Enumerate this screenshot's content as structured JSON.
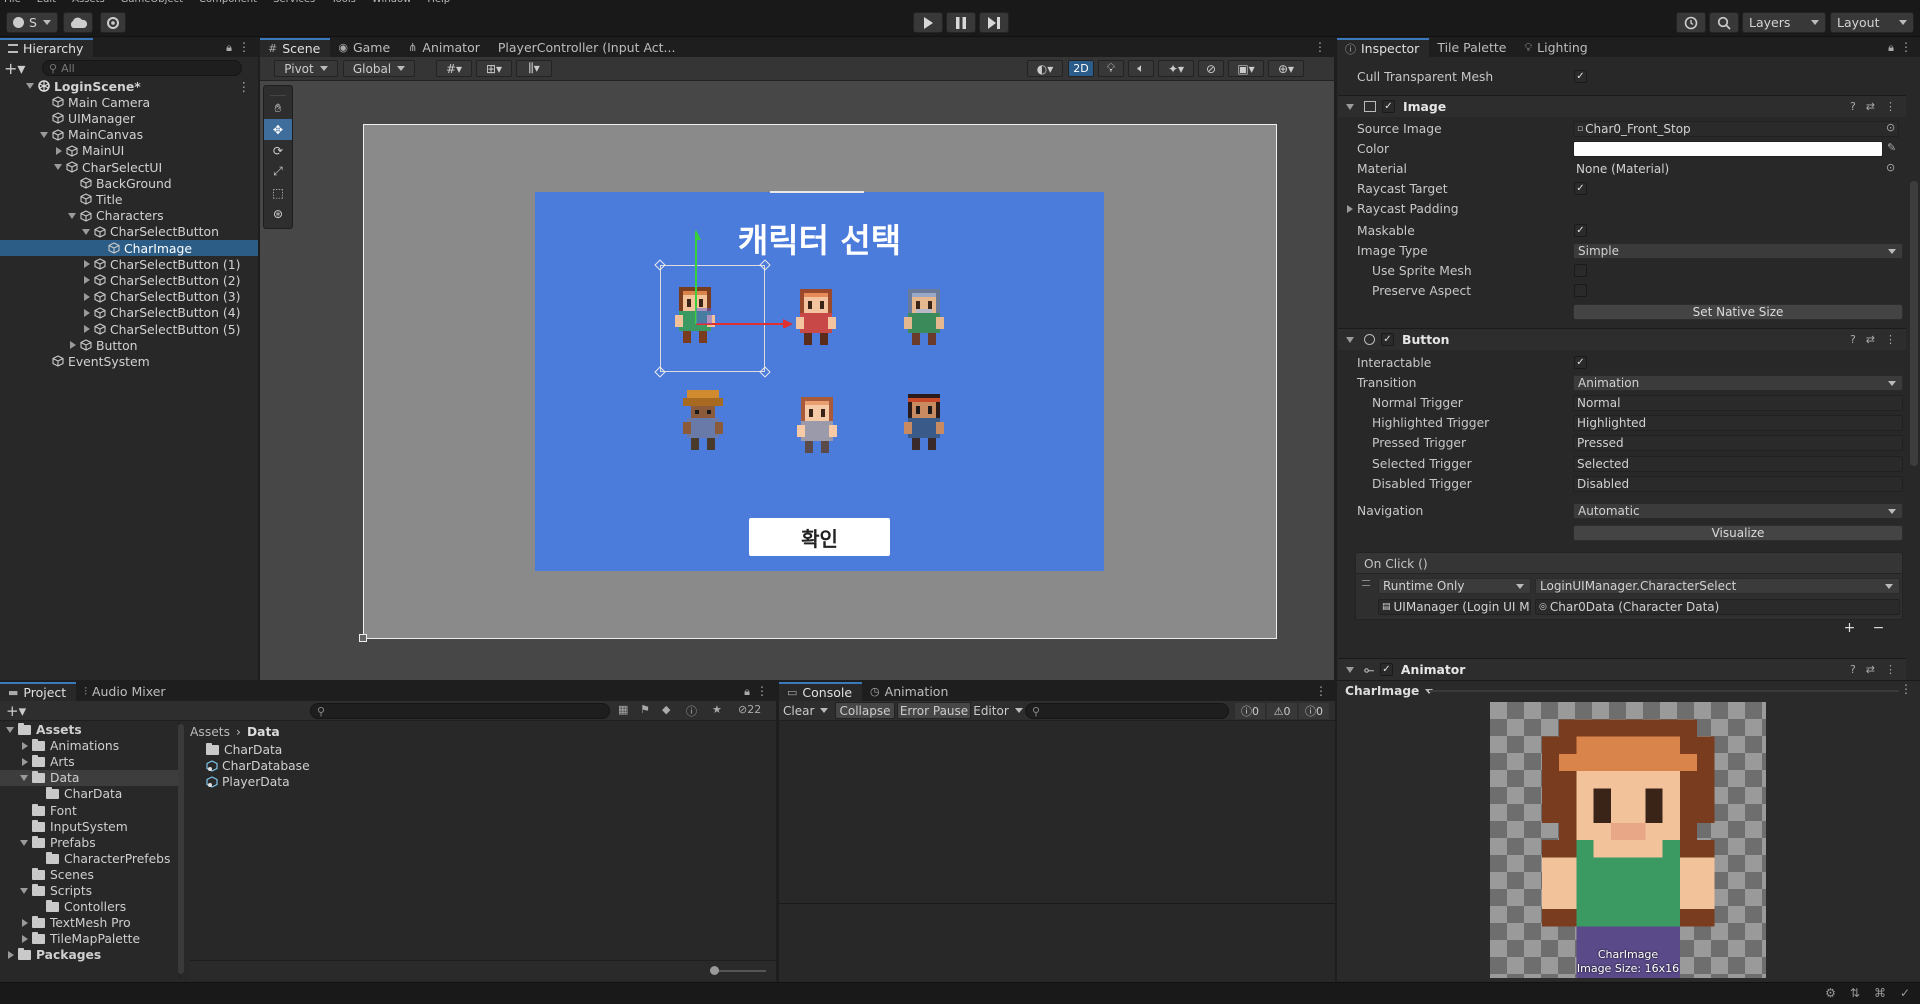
{
  "menubar": [
    "File",
    "Edit",
    "Assets",
    "GameObject",
    "Component",
    "Services",
    "Tools",
    "Window",
    "Help"
  ],
  "toolbar": {
    "account_label": "S",
    "layers_label": "Layers",
    "layout_label": "Layout"
  },
  "hierarchy": {
    "tab": "Hierarchy",
    "search_placeholder": "All",
    "items": [
      {
        "label": "LoginScene*",
        "depth": 0,
        "fold": "open",
        "kind": "scene"
      },
      {
        "label": "Main Camera",
        "depth": 1,
        "fold": "",
        "kind": "obj"
      },
      {
        "label": "UIManager",
        "depth": 1,
        "fold": "",
        "kind": "obj"
      },
      {
        "label": "MainCanvas",
        "depth": 1,
        "fold": "open",
        "kind": "obj"
      },
      {
        "label": "MainUI",
        "depth": 2,
        "fold": "closed",
        "kind": "obj"
      },
      {
        "label": "CharSelectUI",
        "depth": 2,
        "fold": "open",
        "kind": "obj"
      },
      {
        "label": "BackGround",
        "depth": 3,
        "fold": "",
        "kind": "obj"
      },
      {
        "label": "Title",
        "depth": 3,
        "fold": "",
        "kind": "obj"
      },
      {
        "label": "Characters",
        "depth": 3,
        "fold": "open",
        "kind": "obj"
      },
      {
        "label": "CharSelectButton",
        "depth": 4,
        "fold": "open",
        "kind": "obj"
      },
      {
        "label": "CharImage",
        "depth": 5,
        "fold": "",
        "kind": "obj",
        "selected": true
      },
      {
        "label": "CharSelectButton (1)",
        "depth": 4,
        "fold": "closed",
        "kind": "obj"
      },
      {
        "label": "CharSelectButton (2)",
        "depth": 4,
        "fold": "closed",
        "kind": "obj"
      },
      {
        "label": "CharSelectButton (3)",
        "depth": 4,
        "fold": "closed",
        "kind": "obj"
      },
      {
        "label": "CharSelectButton (4)",
        "depth": 4,
        "fold": "closed",
        "kind": "obj"
      },
      {
        "label": "CharSelectButton (5)",
        "depth": 4,
        "fold": "closed",
        "kind": "obj"
      },
      {
        "label": "Button",
        "depth": 3,
        "fold": "closed",
        "kind": "obj"
      },
      {
        "label": "EventSystem",
        "depth": 1,
        "fold": "",
        "kind": "obj"
      }
    ]
  },
  "scene": {
    "tabs": [
      "Scene",
      "Game",
      "Animator",
      "PlayerController (Input Act..."
    ],
    "pivot_label": "Pivot",
    "global_label": "Global",
    "mode_2d_label": "2D",
    "game_title": "캐릭터 선택",
    "confirm_label": "확인",
    "bg_color": "#4b7bdb"
  },
  "inspector": {
    "tabs": [
      "Inspector",
      "Tile Palette",
      "Lighting"
    ],
    "cull_label": "Cull Transparent Mesh",
    "image": {
      "title": "Image",
      "source_image_label": "Source Image",
      "source_image_value": "Char0_Front_Stop",
      "color_label": "Color",
      "material_label": "Material",
      "material_value": "None (Material)",
      "raycast_target_label": "Raycast Target",
      "raycast_padding_label": "Raycast Padding",
      "maskable_label": "Maskable",
      "image_type_label": "Image Type",
      "image_type_value": "Simple",
      "use_sprite_mesh_label": "Use Sprite Mesh",
      "preserve_aspect_label": "Preserve Aspect",
      "set_native_size_label": "Set Native Size"
    },
    "button": {
      "title": "Button",
      "interactable_label": "Interactable",
      "transition_label": "Transition",
      "transition_value": "Animation",
      "triggers": [
        {
          "label": "Normal Trigger",
          "value": "Normal"
        },
        {
          "label": "Highlighted Trigger",
          "value": "Highlighted"
        },
        {
          "label": "Pressed Trigger",
          "value": "Pressed"
        },
        {
          "label": "Selected Trigger",
          "value": "Selected"
        },
        {
          "label": "Disabled Trigger",
          "value": "Disabled"
        }
      ],
      "navigation_label": "Navigation",
      "navigation_value": "Automatic",
      "visualize_label": "Visualize",
      "onclick_label": "On Click ()",
      "runtime_value": "Runtime Only",
      "function_value": "LoginUIManager.CharacterSelect",
      "target_value": "UIManager (Login UI M",
      "param_value": "Char0Data (Character Data)"
    },
    "animator": {
      "title": "Animator"
    },
    "preview": {
      "object_label": "CharImage",
      "caption_name": "CharImage",
      "caption_size": "Image Size: 16x16"
    }
  },
  "project": {
    "tabs": [
      "Project",
      "Audio Mixer"
    ],
    "hidden_count": "22",
    "tree": [
      {
        "label": "Assets",
        "depth": 0,
        "fold": "open",
        "bold": true
      },
      {
        "label": "Animations",
        "depth": 1,
        "fold": "closed"
      },
      {
        "label": "Arts",
        "depth": 1,
        "fold": "closed"
      },
      {
        "label": "Data",
        "depth": 1,
        "fold": "open",
        "selected": true
      },
      {
        "label": "CharData",
        "depth": 2,
        "fold": ""
      },
      {
        "label": "Font",
        "depth": 1,
        "fold": ""
      },
      {
        "label": "InputSystem",
        "depth": 1,
        "fold": ""
      },
      {
        "label": "Prefabs",
        "depth": 1,
        "fold": "open"
      },
      {
        "label": "CharacterPrefebs",
        "depth": 2,
        "fold": ""
      },
      {
        "label": "Scenes",
        "depth": 1,
        "fold": ""
      },
      {
        "label": "Scripts",
        "depth": 1,
        "fold": "open"
      },
      {
        "label": "Contollers",
        "depth": 2,
        "fold": ""
      },
      {
        "label": "TextMesh Pro",
        "depth": 1,
        "fold": "closed"
      },
      {
        "label": "TileMapPalette",
        "depth": 1,
        "fold": "closed"
      },
      {
        "label": "Packages",
        "depth": 0,
        "fold": "closed",
        "bold": true
      }
    ],
    "breadcrumb": [
      "Assets",
      "Data"
    ],
    "files": [
      {
        "label": "CharData",
        "kind": "folder"
      },
      {
        "label": "CharDatabase",
        "kind": "script"
      },
      {
        "label": "PlayerData",
        "kind": "script"
      }
    ]
  },
  "console": {
    "tabs": [
      "Console",
      "Animation"
    ],
    "clear_label": "Clear",
    "collapse_label": "Collapse",
    "error_pause_label": "Error Pause",
    "editor_label": "Editor",
    "log_count": "0",
    "warn_count": "0",
    "error_count": "0"
  }
}
